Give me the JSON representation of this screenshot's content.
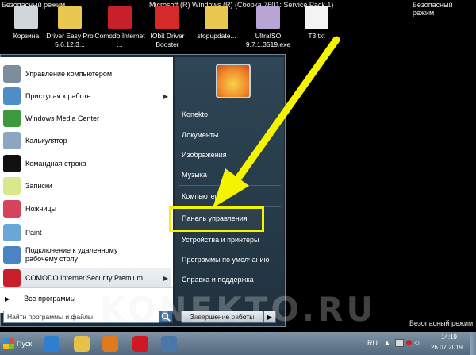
{
  "title_bar": {
    "safe_mode_left": "Безопасный режим",
    "center": "Microsoft (R) Windows (R) (Сборка 7601: Service Pack 1)",
    "safe_mode_right": "Безопасный режим"
  },
  "desktop_icons": [
    {
      "label": "Корзина",
      "icon": "recycle-bin-icon",
      "color": "#cfd6dc"
    },
    {
      "label": "Driver Easy Pro 5.6.12.3...",
      "icon": "folder-icon",
      "color": "#e8c84e"
    },
    {
      "label": "Comodo Internet ...",
      "icon": "comodo-icon",
      "color": "#c8202a"
    },
    {
      "label": "IObit Driver Booster",
      "icon": "iobit-icon",
      "color": "#d42a2a"
    },
    {
      "label": "stopupdate...",
      "icon": "folder-icon",
      "color": "#e8c84e"
    },
    {
      "label": "UltraISO 9.7.1.3519.exe",
      "icon": "disc-icon",
      "color": "#b9a4d6"
    },
    {
      "label": "T3.txt",
      "icon": "text-file-icon",
      "color": "#f3f3f3"
    }
  ],
  "start_menu": {
    "programs": [
      {
        "label": "Управление компьютером",
        "icon": "computer-management-icon",
        "color": "#7c8d9e",
        "arrow": ""
      },
      {
        "label": "Приступая к работе",
        "icon": "getting-started-icon",
        "color": "#4f8fc9",
        "arrow": "▶"
      },
      {
        "label": "Windows Media Center",
        "icon": "media-center-icon",
        "color": "#3c9a3c",
        "arrow": ""
      },
      {
        "label": "Калькулятор",
        "icon": "calculator-icon",
        "color": "#8aa6c1",
        "arrow": ""
      },
      {
        "label": "Командная строка",
        "icon": "command-prompt-icon",
        "color": "#111111",
        "arrow": ""
      },
      {
        "label": "Записки",
        "icon": "sticky-notes-icon",
        "color": "#d8e88a",
        "arrow": ""
      },
      {
        "label": "Ножницы",
        "icon": "snipping-tool-icon",
        "color": "#d4445c",
        "arrow": ""
      },
      {
        "label": "Paint",
        "icon": "paint-icon",
        "color": "#6aa7d6",
        "arrow": ""
      },
      {
        "label": "Подключение к удаленному рабочему столу",
        "icon": "remote-desktop-icon",
        "color": "#4b84c2",
        "arrow": ""
      },
      {
        "label": "COMODO Internet Security Premium",
        "icon": "comodo-icon",
        "color": "#c8202a",
        "arrow": "▶"
      }
    ],
    "all_programs": "Все программы",
    "search_placeholder": "Найти программы и файлы",
    "right_items": {
      "konekto": "Konekto",
      "documents": "Документы",
      "images": "Изображения",
      "music": "Музыка",
      "computer": "Компьютер",
      "control_panel": "Панель управления",
      "devices": "Устройства и принтеры",
      "default_programs": "Программы по умолчанию",
      "help": "Справка и поддержка"
    },
    "shutdown_label": "Завершение работы",
    "shutdown_arrow": "▶"
  },
  "taskbar": {
    "start_label": "Пуск",
    "pinned": [
      {
        "icon": "internet-explorer-icon",
        "color": "#2e7fd0"
      },
      {
        "icon": "explorer-folder-icon",
        "color": "#e5c14a"
      },
      {
        "icon": "media-player-icon",
        "color": "#e07a1f"
      },
      {
        "icon": "opera-icon",
        "color": "#d01822"
      },
      {
        "icon": "vk-icon",
        "color": "#4a76a8"
      }
    ],
    "language": "RU",
    "time": "14:19",
    "date": "26.07.2019"
  },
  "overlay": {
    "watermark": "KONEKTO.RU",
    "safe_mode_bottom": "Безопасный режим",
    "arrow_color": "#f4f400"
  }
}
